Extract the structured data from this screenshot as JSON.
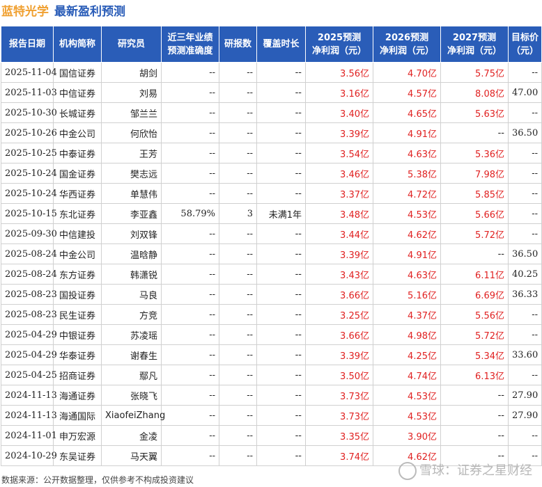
{
  "title": {
    "company": "蓝特光学",
    "main": "最新盈利预测"
  },
  "table": {
    "headers": [
      "报告日期",
      "机构简称",
      "研究员",
      "近三年业绩\n预测准确度",
      "研报数",
      "覆盖时长",
      "2025预测\n净利润（元）",
      "2026预测\n净利润（元）",
      "2027预测\n净利润（元）",
      "目标价\n（元）"
    ],
    "rows": [
      [
        "2025-11-04",
        "国信证券",
        "胡剑",
        "--",
        "--",
        "--",
        "3.56亿",
        "4.70亿",
        "5.75亿",
        "--"
      ],
      [
        "2025-11-03",
        "中信证券",
        "刘易",
        "--",
        "--",
        "--",
        "3.16亿",
        "4.57亿",
        "8.08亿",
        "47.00"
      ],
      [
        "2025-10-30",
        "长城证券",
        "邹兰兰",
        "--",
        "--",
        "--",
        "3.40亿",
        "4.65亿",
        "5.63亿",
        "--"
      ],
      [
        "2025-10-26",
        "中金公司",
        "何欣怡",
        "--",
        "--",
        "--",
        "3.39亿",
        "4.91亿",
        "--",
        "36.50"
      ],
      [
        "2025-10-25",
        "中泰证券",
        "王芳",
        "--",
        "--",
        "--",
        "3.54亿",
        "4.63亿",
        "5.36亿",
        "--"
      ],
      [
        "2025-10-24",
        "国金证券",
        "樊志远",
        "--",
        "--",
        "--",
        "3.46亿",
        "5.38亿",
        "7.98亿",
        "--"
      ],
      [
        "2025-10-24",
        "华西证券",
        "单慧伟",
        "--",
        "--",
        "--",
        "3.37亿",
        "4.72亿",
        "5.85亿",
        "--"
      ],
      [
        "2025-10-15",
        "东北证券",
        "李亚鑫",
        "58.79%",
        "3",
        "未满1年",
        "3.48亿",
        "4.53亿",
        "5.66亿",
        "--"
      ],
      [
        "2025-09-30",
        "中信建投",
        "刘双锋",
        "--",
        "--",
        "--",
        "3.44亿",
        "4.62亿",
        "5.72亿",
        "--"
      ],
      [
        "2025-08-24",
        "中金公司",
        "温晗静",
        "--",
        "--",
        "--",
        "3.39亿",
        "4.91亿",
        "--",
        "36.50"
      ],
      [
        "2025-08-24",
        "东方证券",
        "韩潇锐",
        "--",
        "--",
        "--",
        "3.43亿",
        "4.63亿",
        "6.11亿",
        "40.25"
      ],
      [
        "2025-08-23",
        "国投证券",
        "马良",
        "--",
        "--",
        "--",
        "3.66亿",
        "5.16亿",
        "6.69亿",
        "36.33"
      ],
      [
        "2025-08-23",
        "民生证券",
        "方竞",
        "--",
        "--",
        "--",
        "3.25亿",
        "4.37亿",
        "5.56亿",
        "--"
      ],
      [
        "2025-04-29",
        "中银证券",
        "苏凌瑶",
        "--",
        "--",
        "--",
        "3.66亿",
        "4.98亿",
        "5.72亿",
        "--"
      ],
      [
        "2025-04-29",
        "华泰证券",
        "谢春生",
        "--",
        "--",
        "--",
        "3.39亿",
        "4.25亿",
        "5.34亿",
        "33.60"
      ],
      [
        "2025-04-25",
        "招商证券",
        "鄢凡",
        "--",
        "--",
        "--",
        "3.50亿",
        "4.74亿",
        "6.13亿",
        "--"
      ],
      [
        "2024-11-13",
        "海通证券",
        "张晓飞",
        "--",
        "--",
        "--",
        "3.73亿",
        "4.53亿",
        "--",
        "27.90"
      ],
      [
        "2024-11-13",
        "海通国际",
        "XiaofeiZhang",
        "--",
        "--",
        "--",
        "3.73亿",
        "4.53亿",
        "--",
        "27.90"
      ],
      [
        "2024-11-01",
        "申万宏源",
        "金凌",
        "--",
        "--",
        "--",
        "3.35亿",
        "3.90亿",
        "--",
        "--"
      ],
      [
        "2024-10-29",
        "东吴证券",
        "马天翼",
        "--",
        "--",
        "--",
        "3.74亿",
        "4.62亿",
        "--",
        "--"
      ]
    ]
  },
  "footer": {
    "source": "数据来源：公开数据整理，仅供参考不构成投资建议",
    "watermark": "雪球：证券之星财经"
  },
  "colors": {
    "header_bg": "#2a5db8",
    "company": "#f0a030",
    "forecast_value": "#e02020"
  }
}
